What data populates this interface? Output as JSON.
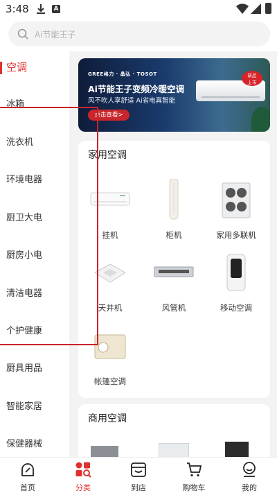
{
  "status_bar": {
    "time": "3:48",
    "a_badge": "A"
  },
  "search": {
    "placeholder": "Ai节能王子"
  },
  "categories": [
    {
      "label": "空调",
      "active": true
    },
    {
      "label": "冰箱"
    },
    {
      "label": "洗衣机"
    },
    {
      "label": "环境电器"
    },
    {
      "label": "厨卫大电"
    },
    {
      "label": "厨房小电"
    },
    {
      "label": "清洁电器"
    },
    {
      "label": "个护健康"
    },
    {
      "label": "厨具用品"
    },
    {
      "label": "智能家居"
    },
    {
      "label": "保健器械"
    }
  ],
  "banner": {
    "brand": "GREE格力 · 晶弘 · TOSOT",
    "title": "Ai节能王子变频冷暖空调",
    "subtitle": "风不吹人享舒适  Ai省电真智能",
    "cta": "点击查看>",
    "tag_line1": "新品",
    "tag_line2": "上市"
  },
  "home_ac": {
    "title": "家用空调",
    "products": [
      {
        "label": "挂机",
        "icon": "wall-mounted-ac"
      },
      {
        "label": "柜机",
        "icon": "floor-standing-ac"
      },
      {
        "label": "家用多联机",
        "icon": "multi-split-outdoor-unit"
      },
      {
        "label": "天井机",
        "icon": "ceiling-cassette-ac"
      },
      {
        "label": "风管机",
        "icon": "ducted-ac"
      },
      {
        "label": "移动空调",
        "icon": "portable-ac"
      },
      {
        "label": "帐篷空调",
        "icon": "tent-ac"
      }
    ]
  },
  "commercial_ac": {
    "title": "商用空调"
  },
  "bottom_nav": [
    {
      "label": "首页",
      "icon": "home-icon"
    },
    {
      "label": "分类",
      "icon": "category-icon",
      "active": true
    },
    {
      "label": "到店",
      "icon": "store-icon"
    },
    {
      "label": "购物车",
      "icon": "cart-icon"
    },
    {
      "label": "我的",
      "icon": "profile-icon"
    }
  ],
  "colors": {
    "accent": "#e03030",
    "highlight_border": "#c8232c"
  }
}
